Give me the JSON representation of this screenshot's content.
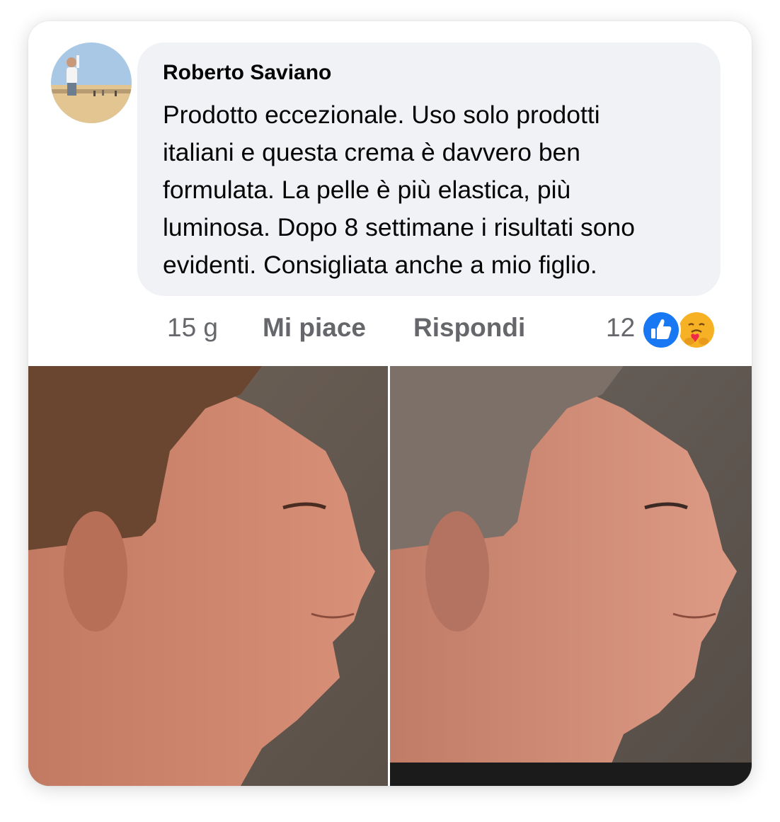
{
  "comment": {
    "author": "Roberto Saviano",
    "text_lines": [
      "Prodotto eccezionale. Uso solo prodotti",
      "italiani e questa crema è davvero ben",
      "formulata. La pelle è più elastica, più",
      "luminosa. Dopo 8 settimane i risultati sono",
      "evidenti. Consigliata anche a mio figlio."
    ]
  },
  "actions": {
    "time": "15 g",
    "like_label": "Mi piace",
    "reply_label": "Rispondi",
    "reaction_count": "12"
  },
  "icons": {
    "like_reaction": "thumbs-up-icon",
    "care_reaction": "care-emoji-icon"
  },
  "colors": {
    "bubble_background": "#f0f2f5",
    "text": "#050505",
    "secondary_text": "#65676b",
    "like_blue": "#1877f2",
    "care_yellow": "#f7b125"
  }
}
